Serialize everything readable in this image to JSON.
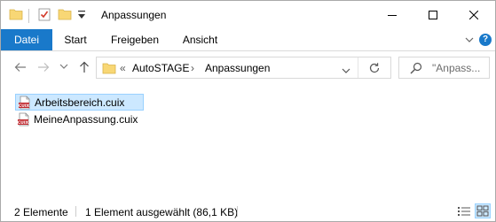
{
  "window": {
    "title": "Anpassungen"
  },
  "ribbon": {
    "tabs": [
      {
        "label": "Datei"
      },
      {
        "label": "Start"
      },
      {
        "label": "Freigeben"
      },
      {
        "label": "Ansicht"
      }
    ]
  },
  "address": {
    "overflow_prefix": "«",
    "breadcrumbs": [
      "AutoSTAGE",
      "Anpassungen"
    ],
    "separator": "›"
  },
  "search": {
    "placeholder": "\"Anpass..."
  },
  "files": [
    {
      "name": "Arbeitsbereich.cuix",
      "icon": "cuix-file-icon",
      "selected": true
    },
    {
      "name": "MeineAnpassung.cuix",
      "icon": "cuix-file-icon",
      "selected": false
    }
  ],
  "status": {
    "item_count": "2 Elemente",
    "selection": "1 Element ausgewählt (86,1 KB)"
  },
  "colors": {
    "accent": "#1979ca",
    "selection_bg": "#cce8ff",
    "selection_border": "#99d1ff",
    "folder": "#f8d775",
    "cuix_red": "#c0272d"
  }
}
